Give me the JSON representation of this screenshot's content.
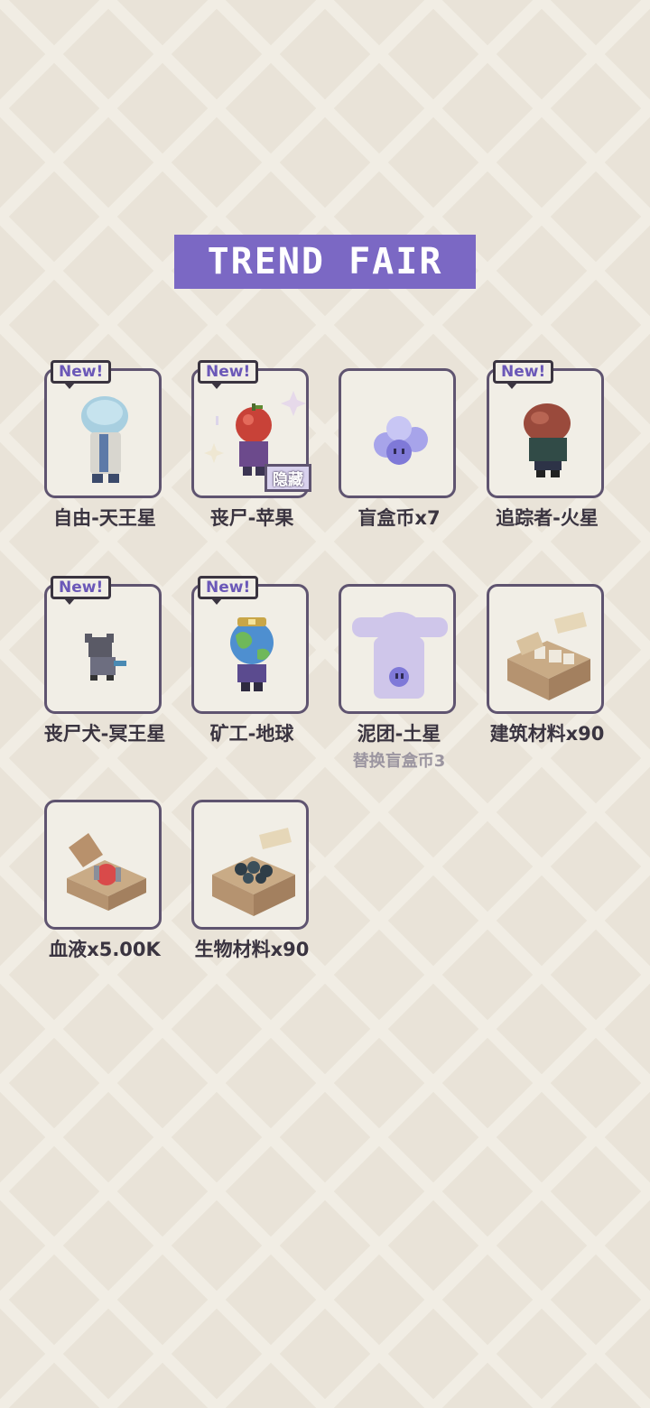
{
  "title": "TREND FAIR",
  "items": [
    {
      "name": "自由-天王星",
      "new": "New!",
      "icon": "uranus-figure-icon"
    },
    {
      "name": "丧尸-苹果",
      "new": "New!",
      "icon": "zombie-apple-icon",
      "hidden": "隐藏"
    },
    {
      "name": "盲盒币x7",
      "icon": "blindbox-coin-icon"
    },
    {
      "name": "追踪者-火星",
      "new": "New!",
      "icon": "mars-tracker-icon"
    },
    {
      "name": "丧尸犬-冥王星",
      "new": "New!",
      "icon": "pluto-dog-icon"
    },
    {
      "name": "矿工-地球",
      "new": "New!",
      "icon": "earth-miner-icon"
    },
    {
      "name": "泥团-土星",
      "icon": "saturn-mud-silhouette-icon",
      "sub": "替换盲盒币3"
    },
    {
      "name": "建筑材料x90",
      "icon": "building-materials-box-icon"
    },
    {
      "name": "血液x5.00K",
      "icon": "blood-box-icon"
    },
    {
      "name": "生物材料x90",
      "icon": "bio-materials-box-icon"
    }
  ]
}
